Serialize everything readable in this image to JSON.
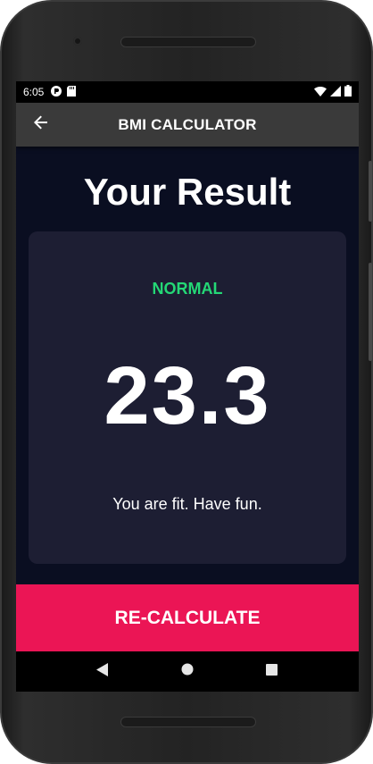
{
  "status_bar": {
    "time": "6:05",
    "left_icons": [
      "notification-icon",
      "sd-card-icon"
    ],
    "right_icons": [
      "wifi-icon",
      "signal-icon",
      "battery-icon"
    ]
  },
  "app_bar": {
    "title": "BMI CALCULATOR",
    "back_icon": "arrow-left-icon"
  },
  "main": {
    "heading": "Your Result",
    "card": {
      "status": "NORMAL",
      "value": "23.3",
      "advice": "You are fit. Have fun."
    },
    "recalculate_label": "RE-CALCULATE"
  },
  "nav_bar": {
    "icons": [
      "back-triangle-icon",
      "home-circle-icon",
      "recents-square-icon"
    ]
  },
  "colors": {
    "background": "#0a0e21",
    "card": "#1d1e33",
    "app_bar": "#3a3a3a",
    "status_normal": "#24d876",
    "accent": "#eb1555"
  }
}
